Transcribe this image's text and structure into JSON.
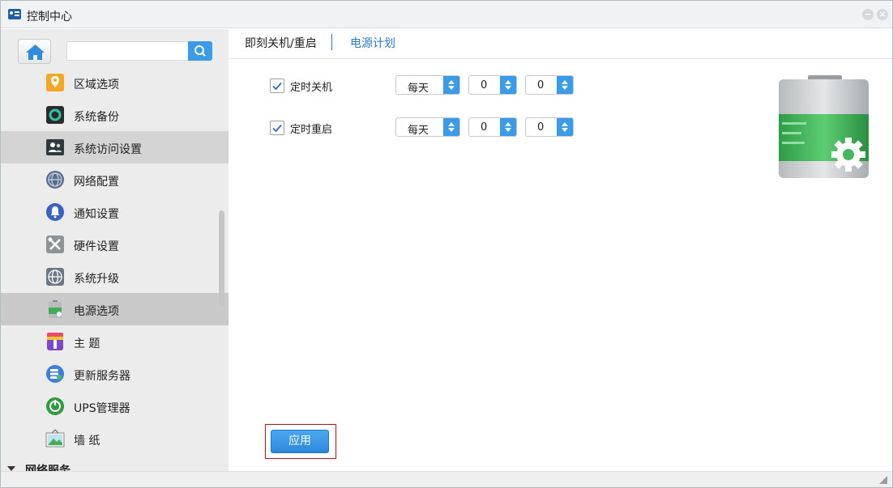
{
  "window": {
    "title": "控制中心"
  },
  "sidebar": {
    "search_placeholder": "",
    "items": [
      {
        "label": "区域选项",
        "icon": "location-pin-icon"
      },
      {
        "label": "系统备份",
        "icon": "backup-icon"
      },
      {
        "label": "系统访问设置",
        "icon": "users-access-icon"
      },
      {
        "label": "网络配置",
        "icon": "network-globe-icon"
      },
      {
        "label": "通知设置",
        "icon": "notification-bell-icon"
      },
      {
        "label": "硬件设置",
        "icon": "tools-icon"
      },
      {
        "label": "系统升级",
        "icon": "upgrade-globe-icon"
      },
      {
        "label": "电源选项",
        "icon": "battery-icon"
      },
      {
        "label": "主 题",
        "icon": "theme-palette-icon"
      },
      {
        "label": "更新服务器",
        "icon": "update-server-icon"
      },
      {
        "label": "UPS管理器",
        "icon": "ups-icon"
      },
      {
        "label": "墙 纸",
        "icon": "wallpaper-icon"
      }
    ],
    "section_label": "网络服务"
  },
  "tabs": [
    {
      "label": "即刻关机/重启",
      "active": true
    },
    {
      "label": "电源计划",
      "active": false
    }
  ],
  "schedule": [
    {
      "label": "定时关机",
      "checked": true,
      "frequency": "每天",
      "hour": "0",
      "minute": "0"
    },
    {
      "label": "定时重启",
      "checked": true,
      "frequency": "每天",
      "hour": "0",
      "minute": "0"
    }
  ],
  "apply_label": "应用",
  "colors": {
    "accent": "#3a9be8",
    "highlight_border": "#b41d1d",
    "tab_active_link": "#2f78c6"
  }
}
